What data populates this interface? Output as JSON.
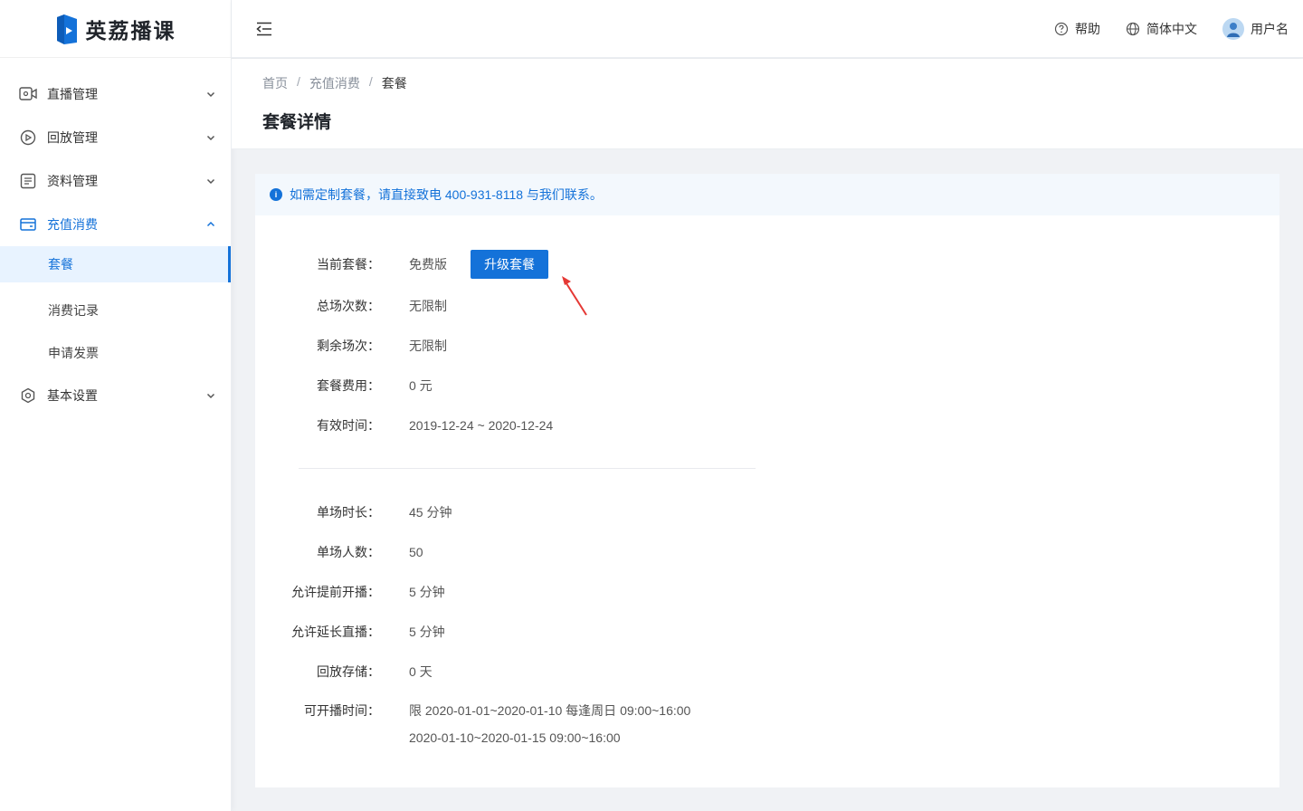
{
  "app": {
    "logo_text": "英荔播课"
  },
  "sidebar": {
    "items": [
      {
        "label": "直播管理",
        "icon": "video-camera-icon"
      },
      {
        "label": "回放管理",
        "icon": "replay-icon"
      },
      {
        "label": "资料管理",
        "icon": "document-icon"
      },
      {
        "label": "充值消费",
        "icon": "wallet-icon",
        "open": true,
        "children": [
          {
            "label": "套餐",
            "active": true
          },
          {
            "label": "消费记录"
          },
          {
            "label": "申请发票"
          }
        ]
      },
      {
        "label": "基本设置",
        "icon": "settings-icon"
      }
    ]
  },
  "header": {
    "help_label": "帮助",
    "language_label": "简体中文",
    "user_label": "用户名"
  },
  "breadcrumb": [
    "首页",
    "充值消费",
    "套餐"
  ],
  "page_title": "套餐详情",
  "notice": "如需定制套餐，请直接致电 400-931-8118 与我们联系。",
  "plan": {
    "current_label": "当前套餐：",
    "current_value": "免费版",
    "upgrade_label": "升级套餐",
    "rows_top": [
      {
        "label": "总场次数：",
        "value": "无限制"
      },
      {
        "label": "剩余场次：",
        "value": "无限制"
      },
      {
        "label": "套餐费用：",
        "value": "0 元"
      },
      {
        "label": "有效时间：",
        "value": "2019-12-24 ~ 2020-12-24"
      }
    ],
    "rows_bottom": [
      {
        "label": "单场时长：",
        "value": "45 分钟"
      },
      {
        "label": "单场人数：",
        "value": "50"
      },
      {
        "label": "允许提前开播：",
        "value": "5 分钟"
      },
      {
        "label": "允许延长直播：",
        "value": "5 分钟"
      },
      {
        "label": "回放存储：",
        "value": "0 天"
      }
    ],
    "broadcast_time_label": "可开播时间：",
    "broadcast_time_lines": [
      "限 2020-01-01~2020-01-10  每逢周日 09:00~16:00",
      "2020-01-10~2020-01-15  09:00~16:00"
    ]
  },
  "colors": {
    "primary": "#1472d9",
    "annotation_arrow": "#e53935"
  }
}
